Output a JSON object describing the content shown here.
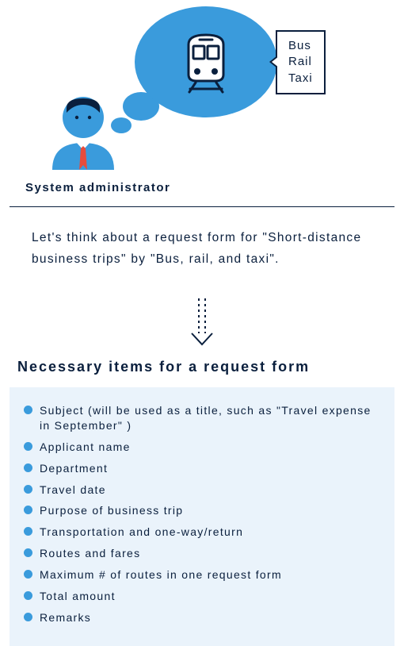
{
  "speech": {
    "line1": "Bus",
    "line2": "Rail",
    "line3": "Taxi"
  },
  "caption": "System administrator",
  "intro": "Let's think about a request form for \"Short-distance business trips\" by \"Bus, rail, and taxi\".",
  "section_title": "Necessary items for a request form",
  "items": [
    "Subject (will be used as a title, such as \"Travel expense in September\" )",
    "Applicant name",
    "Department",
    "Travel date",
    "Purpose of business trip",
    "Transportation and one-way/return",
    "Routes and fares",
    "Maximum # of routes in one request form",
    "Total amount",
    "Remarks"
  ]
}
